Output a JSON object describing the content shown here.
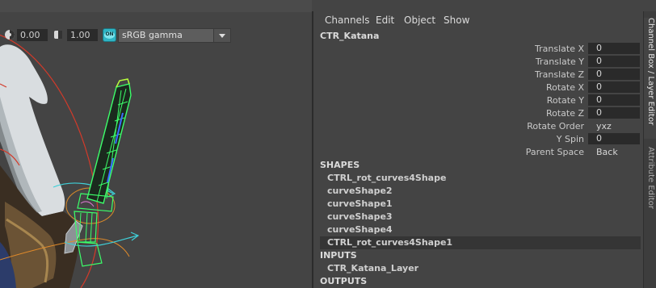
{
  "viewport": {
    "exposure_value": "0.00",
    "gamma_value": "1.00",
    "color_management_badge": "ON",
    "color_space": "sRGB gamma"
  },
  "channel_box": {
    "menus": [
      "Channels",
      "Edit",
      "Object",
      "Show"
    ],
    "object_name": "CTR_Katana",
    "attributes": [
      {
        "label": "Translate X",
        "value": "0",
        "kind": "field"
      },
      {
        "label": "Translate Y",
        "value": "0",
        "kind": "field"
      },
      {
        "label": "Translate Z",
        "value": "0",
        "kind": "field"
      },
      {
        "label": "Rotate X",
        "value": "0",
        "kind": "field"
      },
      {
        "label": "Rotate Y",
        "value": "0",
        "kind": "field"
      },
      {
        "label": "Rotate Z",
        "value": "0",
        "kind": "field"
      },
      {
        "label": "Rotate Order",
        "value": "yxz",
        "kind": "text"
      },
      {
        "label": "Y Spin",
        "value": "0",
        "kind": "field"
      },
      {
        "label": "Parent Space",
        "value": "Back",
        "kind": "text"
      }
    ],
    "shapes_header": "SHAPES",
    "shapes": [
      "CTRL_rot_curves4Shape",
      "curveShape2",
      "curveShape1",
      "curveShape3",
      "curveShape4",
      "CTRL_rot_curves4Shape1"
    ],
    "selected_shape_index": 5,
    "inputs_header": "INPUTS",
    "inputs": [
      "CTR_Katana_Layer"
    ],
    "outputs_header": "OUTPUTS"
  },
  "side_tabs": {
    "channel_box": "Channel Box / Layer Editor",
    "attribute_editor": "Attribute Editor"
  },
  "colors": {
    "panel_bg": "#444444",
    "field_bg": "#2a2a2a",
    "selection_row": "#353535",
    "badge_cyan": "#2fb4c4",
    "wire_green": "#3cff6a",
    "wire_blue": "#3b6cff",
    "curve_red": "#d23a2a",
    "curve_orange": "#e08a2a",
    "curve_cyan": "#3fd0d8"
  }
}
